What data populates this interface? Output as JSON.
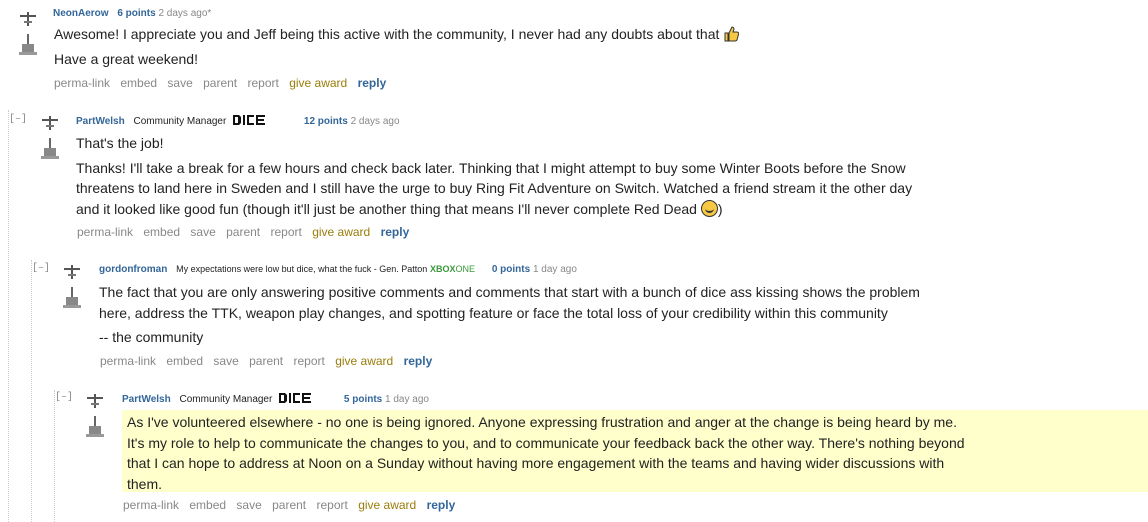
{
  "comments": [
    {
      "author": "NeonAerow",
      "flair": "",
      "points": "6 points",
      "time": "2 days ago*",
      "paragraphs": [
        "Awesome! I appreciate you and Jeff being this active with the community, I never had any doubts about that",
        "Have a great weekend!"
      ],
      "emoji": "thumbs-up-icon"
    },
    {
      "collapse": "[–]",
      "author": "PartWelsh",
      "flair": "Community Manager",
      "points": "12 points",
      "time": "2 days ago",
      "paragraphs": [
        "That's the job!",
        "Thanks! I'll take a break for a few hours and check back later. Thinking that I might attempt to buy some Winter Boots before the Snow threatens to land here in Sweden and I still have the urge to buy Ring Fit Adventure on Switch. Watched a friend stream it the other day and it looked like good fun (though it'll just be another thing that means I'll never complete Red Dead",
        ")"
      ]
    },
    {
      "collapse": "[–]",
      "author": "gordonfroman",
      "flair": "My expectations were low but dice, what the fuck - Gen. Patton",
      "flair_platform": "XBOX",
      "flair_platform_suffix": "ONE",
      "points": "0 points",
      "time": "1 day ago",
      "paragraphs": [
        "The fact that you are only answering positive comments and comments that start with a bunch of dice ass kissing shows the problem here, address the TTK, weapon play changes, and spotting feature or face the total loss of your credibility within this community",
        "-- the community"
      ]
    },
    {
      "collapse": "[–]",
      "author": "PartWelsh",
      "flair": "Community Manager",
      "points": "5 points",
      "time": "1 day ago",
      "paragraphs": [
        "As I've volunteered elsewhere - no one is being ignored. Anyone expressing frustration and anger at the change is being heard by me. It's my role to help to communicate the changes to you, and to communicate your feedback back the other way. There's nothing beyond that I can hope to address at Noon on a Sunday without having more engagement with the teams and having wider discussions with them."
      ]
    }
  ],
  "buttons": {
    "permalink": "perma-link",
    "embed": "embed",
    "save": "save",
    "parent": "parent",
    "report": "report",
    "give_award": "give award",
    "reply": "reply"
  },
  "colors": {
    "author": "#336699",
    "award": "#9a7d0a",
    "highlight": "#ffffcc",
    "xbox": "#3a9a3a"
  }
}
